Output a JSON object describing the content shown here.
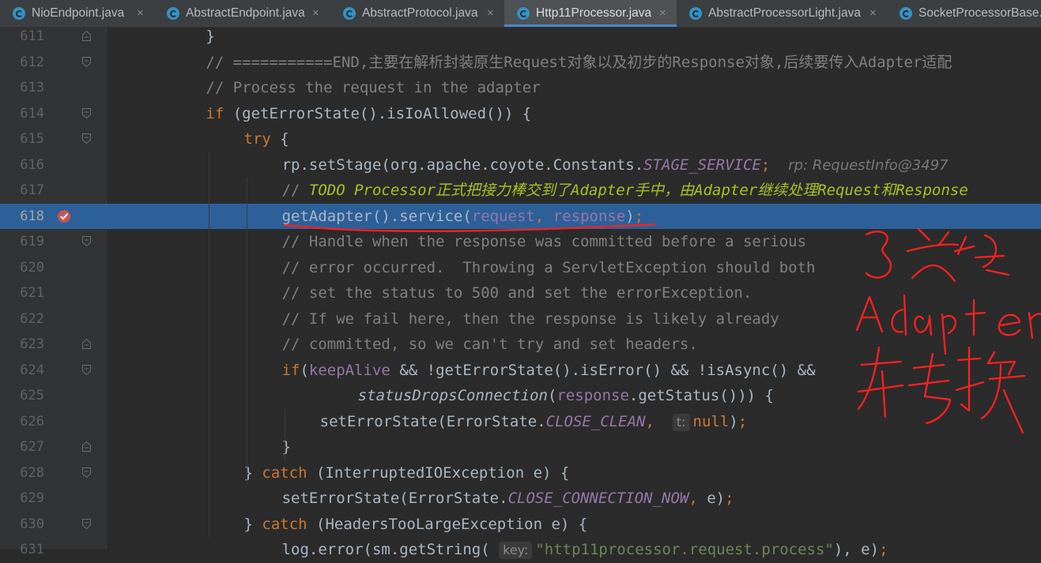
{
  "tabs": [
    {
      "label": "NioEndpoint.java",
      "close": "×",
      "active": false
    },
    {
      "label": "AbstractEndpoint.java",
      "close": "×",
      "active": false
    },
    {
      "label": "AbstractProtocol.java",
      "close": "×",
      "active": false
    },
    {
      "label": "Http11Processor.java",
      "close": "×",
      "active": true
    },
    {
      "label": "AbstractProcessorLight.java",
      "close": "×",
      "active": false
    },
    {
      "label": "SocketProcessorBase.java",
      "close": "",
      "active": false
    }
  ],
  "lines": [
    {
      "n": "611",
      "fold": "end",
      "tokens": [
        [
          "p",
          "}"
        ]
      ]
    },
    {
      "n": "612",
      "fold": "start",
      "tokens": [
        [
          "cm",
          "// ===========END,主要在解析封装原生Request对象以及初步的Response对象,后续要传入Adapter适配"
        ]
      ]
    },
    {
      "n": "613",
      "fold": "",
      "tokens": [
        [
          "cm",
          "// Process the request in the adapter"
        ]
      ]
    },
    {
      "n": "614",
      "fold": "start",
      "tokens": [
        [
          "kw",
          "if "
        ],
        [
          "p",
          "(getErrorState().isIoAllowed()) {"
        ]
      ]
    },
    {
      "n": "615",
      "fold": "start",
      "tokens": [
        [
          "kw",
          "try "
        ],
        [
          "p",
          "{"
        ]
      ]
    },
    {
      "n": "616",
      "fold": "",
      "tokens": [
        [
          "p",
          "rp.setStage(org.apache.coyote.Constants."
        ],
        [
          "st",
          "STAGE_SERVICE"
        ],
        [
          "kw",
          ";"
        ],
        [
          "p",
          "  "
        ],
        [
          "hint",
          "rp: RequestInfo@3497"
        ]
      ]
    },
    {
      "n": "617",
      "fold": "",
      "tokens": [
        [
          "cm",
          "// "
        ],
        [
          "todo",
          "TODO Processor正式把接力棒交到了Adapter手中，由Adapter继续处理Request和Response"
        ]
      ]
    },
    {
      "n": "618",
      "fold": "",
      "breakpoint": true,
      "highlight": true,
      "tokens": [
        [
          "p",
          "getAdapter().service("
        ],
        [
          "fld",
          "request"
        ],
        [
          "kw",
          ", "
        ],
        [
          "fld",
          "response"
        ],
        [
          "p",
          ")"
        ],
        [
          "kw",
          ";"
        ]
      ]
    },
    {
      "n": "619",
      "fold": "start",
      "tokens": [
        [
          "cm",
          "// Handle when the response was committed before a serious"
        ]
      ]
    },
    {
      "n": "620",
      "fold": "",
      "tokens": [
        [
          "cm",
          "// error occurred.  Throwing a ServletException should both"
        ]
      ]
    },
    {
      "n": "621",
      "fold": "",
      "tokens": [
        [
          "cm",
          "// set the status to 500 and set the errorException."
        ]
      ]
    },
    {
      "n": "622",
      "fold": "",
      "tokens": [
        [
          "cm",
          "// If we fail here, then the response is likely already"
        ]
      ]
    },
    {
      "n": "623",
      "fold": "end",
      "tokens": [
        [
          "cm",
          "// committed, so we can't try and set headers."
        ]
      ]
    },
    {
      "n": "624",
      "fold": "start",
      "tokens": [
        [
          "kw",
          "if"
        ],
        [
          "p",
          "("
        ],
        [
          "fld",
          "keepAlive"
        ],
        [
          "p",
          " && !getErrorState().isError() && !isAsync() &&"
        ]
      ]
    },
    {
      "n": "625",
      "fold": "",
      "tokens": [
        [
          "it",
          "statusDropsConnection"
        ],
        [
          "p",
          "("
        ],
        [
          "fld",
          "response"
        ],
        [
          "p",
          ".getStatus())) {"
        ]
      ]
    },
    {
      "n": "626",
      "fold": "",
      "tokens": [
        [
          "p",
          "setErrorState(ErrorState."
        ],
        [
          "st",
          "CLOSE_CLEAN"
        ],
        [
          "kw",
          ", "
        ],
        [
          "p",
          " "
        ],
        [
          "pill",
          "t:"
        ],
        [
          "kw",
          "null"
        ],
        [
          "p",
          ")"
        ],
        [
          "kw",
          ";"
        ]
      ]
    },
    {
      "n": "627",
      "fold": "end",
      "tokens": [
        [
          "p",
          "}"
        ]
      ]
    },
    {
      "n": "628",
      "fold": "start",
      "tokens": [
        [
          "p",
          "} "
        ],
        [
          "kw",
          "catch "
        ],
        [
          "p",
          "(InterruptedIOException e) {"
        ]
      ]
    },
    {
      "n": "629",
      "fold": "",
      "tokens": [
        [
          "p",
          "setErrorState(ErrorState."
        ],
        [
          "st",
          "CLOSE_CONNECTION_NOW"
        ],
        [
          "kw",
          ", "
        ],
        [
          "p",
          "e)"
        ],
        [
          "kw",
          ";"
        ]
      ]
    },
    {
      "n": "630",
      "fold": "start",
      "tokens": [
        [
          "p",
          "} "
        ],
        [
          "kw",
          "catch "
        ],
        [
          "p",
          "(HeadersTooLargeException e) {"
        ]
      ]
    },
    {
      "n": "631",
      "fold": "",
      "tokens": [
        [
          "p",
          "log.error(sm.getString( "
        ],
        [
          "pill",
          "key:"
        ],
        [
          "str",
          "\"http11processor.request.process\""
        ],
        [
          "p",
          "), e)"
        ],
        [
          "kw",
          ";"
        ]
      ]
    }
  ],
  "annotation": {
    "text": "3.交给 Adapter 转换",
    "color": "#ff2020"
  }
}
